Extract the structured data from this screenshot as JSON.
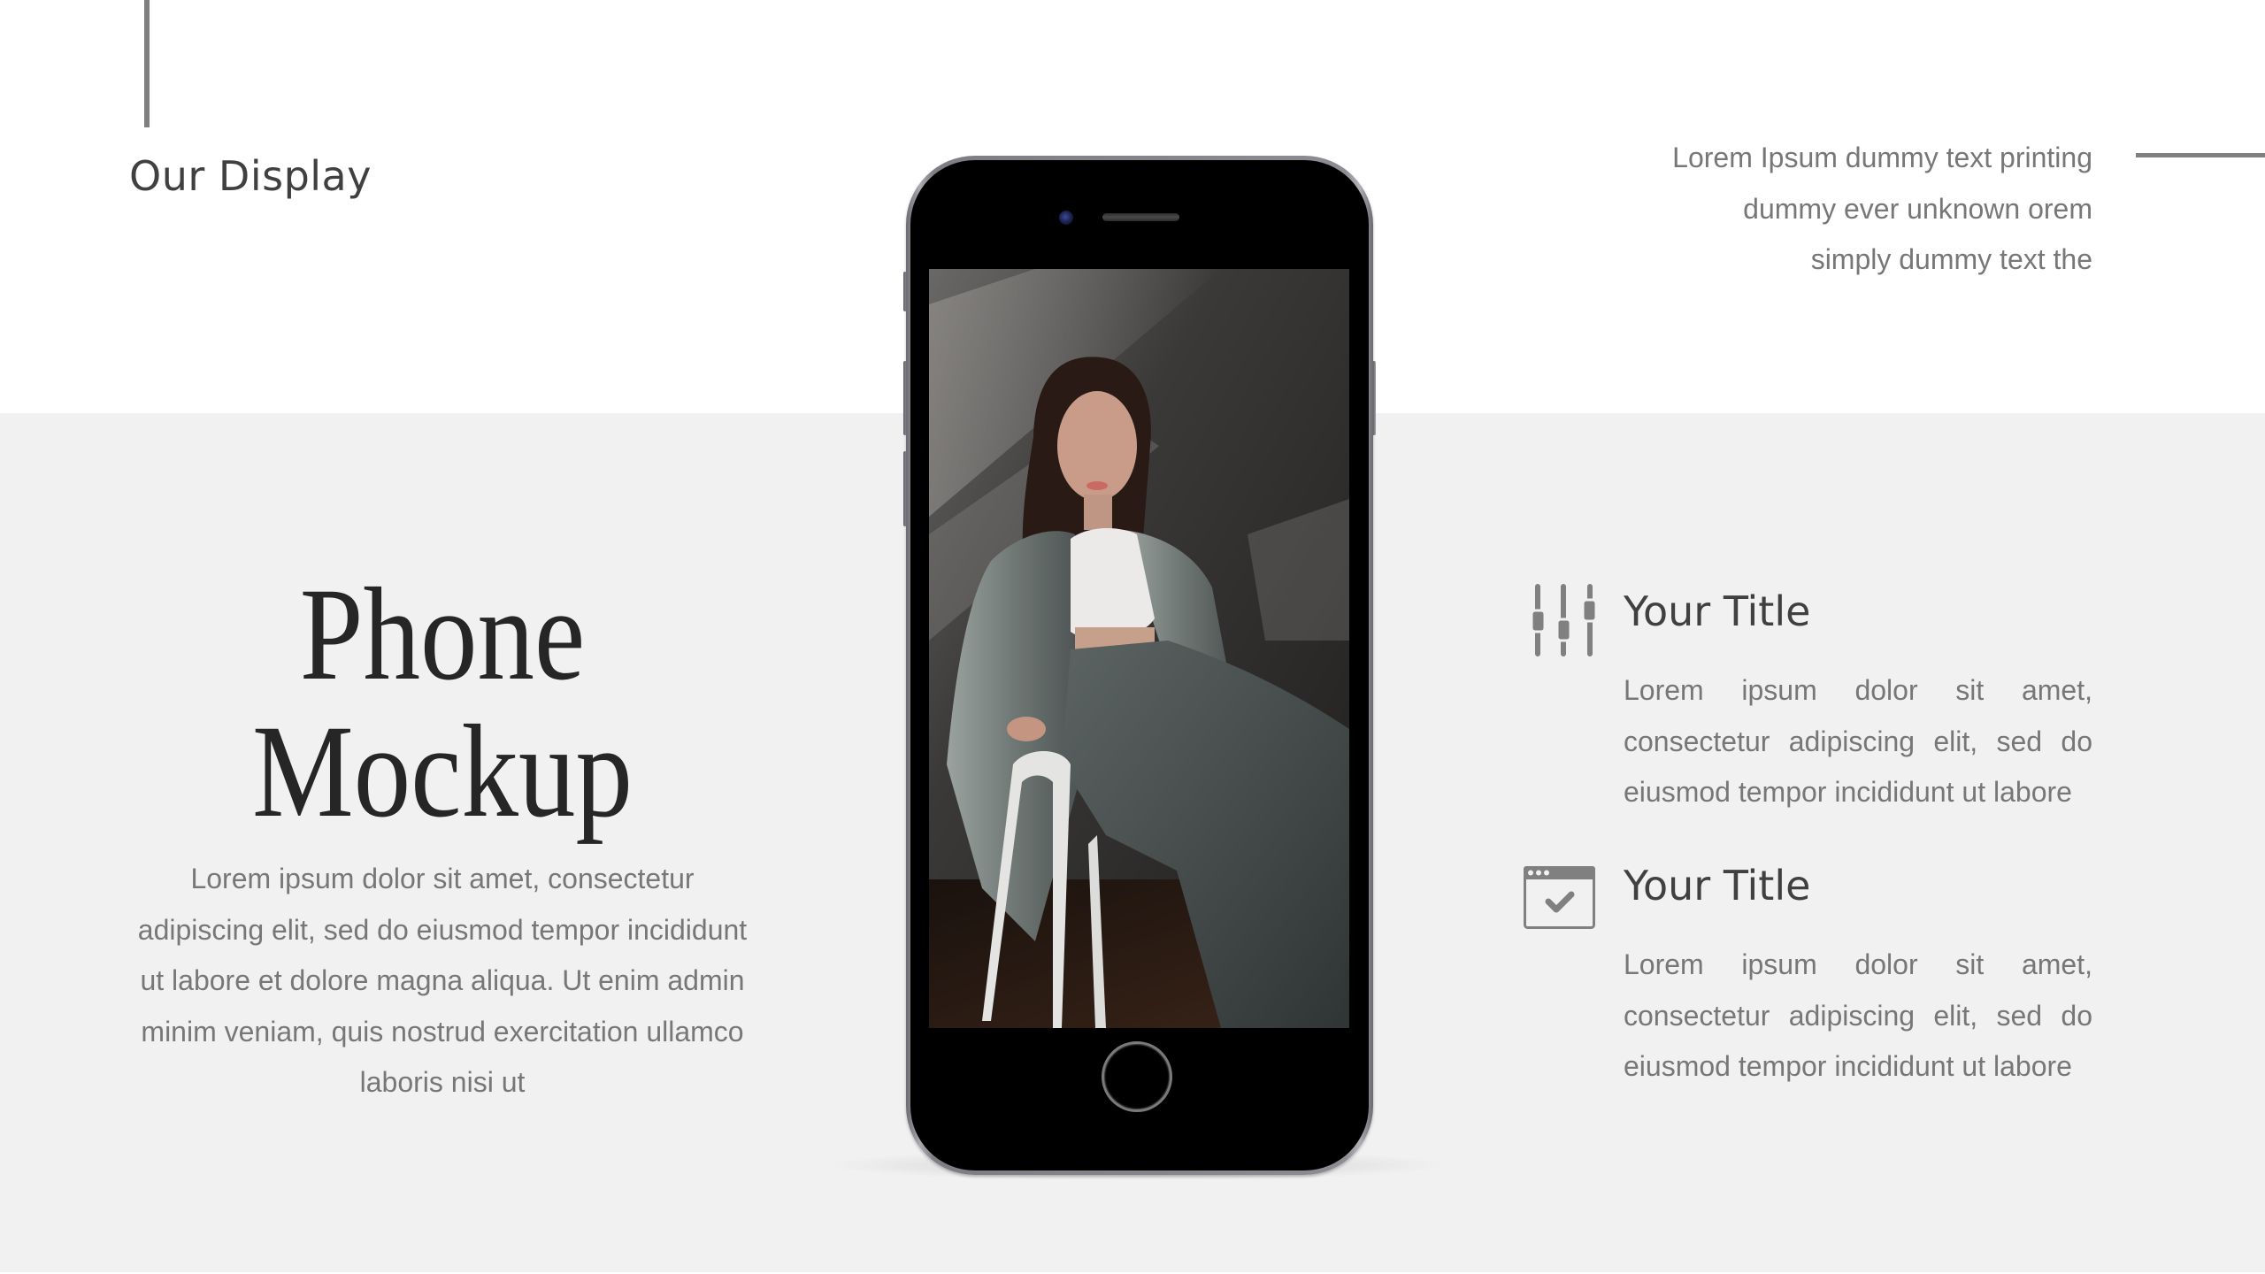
{
  "section": {
    "title": "Our Display"
  },
  "top_note": {
    "lines": "Lorem Ipsum  dummy text printing\ndummy  ever unknown orem\nsimply dummy text  the"
  },
  "hero": {
    "title_line1": "Phone",
    "title_line2": "Mockup",
    "body": "Lorem ipsum dolor sit amet, consectetur adipiscing elit, sed do eiusmod tempor incididunt ut labore et dolore magna aliqua. Ut enim admin minim veniam, quis nostrud exercitation ullamco laboris nisi ut"
  },
  "phone": {
    "screen_image": "woman-in-gray-pinstripe-suit-photo"
  },
  "features": [
    {
      "icon": "sliders-icon",
      "title": "Your Title",
      "body": "Lorem ipsum dolor sit amet, consectetur adipiscing elit, sed do eiusmod tempor incididunt ut labore"
    },
    {
      "icon": "browser-check-icon",
      "title": "Your Title",
      "body": "Lorem ipsum dolor sit amet, consectetur adipiscing elit, sed do eiusmod tempor incididunt ut labore"
    }
  ],
  "colors": {
    "background": "#ffffff",
    "band": "#f1f1f1",
    "heading": "#404040",
    "hero_title": "#262626",
    "body_text": "#777777",
    "accent_line": "#7f7f7f"
  }
}
